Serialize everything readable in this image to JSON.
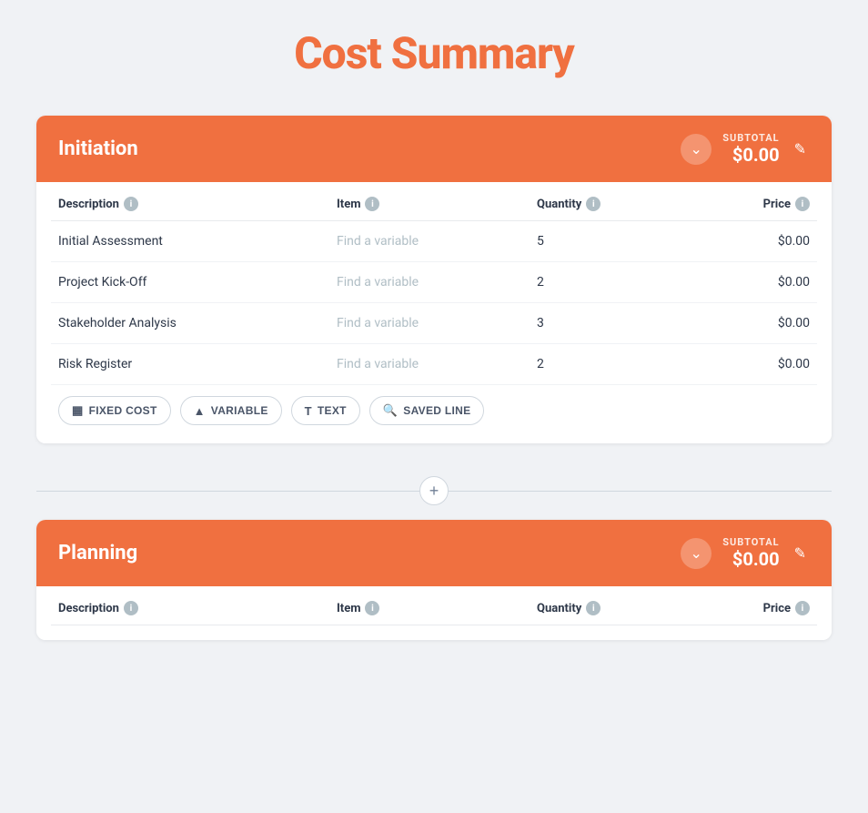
{
  "page": {
    "title": "Cost Summary"
  },
  "sections": [
    {
      "id": "initiation",
      "title": "Initiation",
      "subtotal_label": "SUBTOTAL",
      "subtotal_value": "$0.00",
      "columns": [
        {
          "key": "description",
          "label": "Description"
        },
        {
          "key": "item",
          "label": "Item"
        },
        {
          "key": "quantity",
          "label": "Quantity"
        },
        {
          "key": "price",
          "label": "Price"
        }
      ],
      "rows": [
        {
          "description": "Initial Assessment",
          "item": "Find a variable",
          "quantity": "5",
          "price": "$0.00"
        },
        {
          "description": "Project Kick-Off",
          "item": "Find a variable",
          "quantity": "2",
          "price": "$0.00"
        },
        {
          "description": "Stakeholder Analysis",
          "item": "Find a variable",
          "quantity": "3",
          "price": "$0.00"
        },
        {
          "description": "Risk Register",
          "item": "Find a variable",
          "quantity": "2",
          "price": "$0.00"
        }
      ],
      "actions": [
        {
          "id": "fixed-cost",
          "label": "FIXED COST",
          "icon": "▦"
        },
        {
          "id": "variable",
          "label": "VARIABLE",
          "icon": "▲"
        },
        {
          "id": "text",
          "label": "TEXT",
          "icon": "T"
        },
        {
          "id": "saved-line",
          "label": "SAVED LINE",
          "icon": "🔍"
        }
      ]
    },
    {
      "id": "planning",
      "title": "Planning",
      "subtotal_label": "SUBTOTAL",
      "subtotal_value": "$0.00",
      "columns": [
        {
          "key": "description",
          "label": "Description"
        },
        {
          "key": "item",
          "label": "Item"
        },
        {
          "key": "quantity",
          "label": "Quantity"
        },
        {
          "key": "price",
          "label": "Price"
        }
      ],
      "rows": [],
      "actions": []
    }
  ],
  "add_section_btn": "+",
  "colors": {
    "header_bg": "#f07040",
    "accent": "#f07040"
  }
}
